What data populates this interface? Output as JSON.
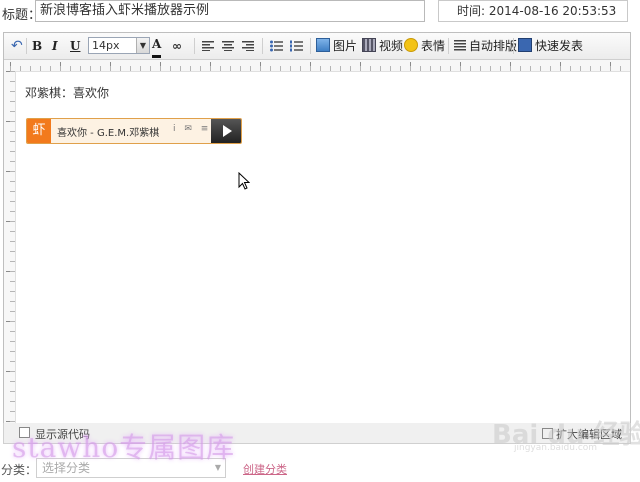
{
  "title_row": {
    "label": "标题：",
    "value": "新浪博客插入虾米播放器示例",
    "time_text": "时间: 2014-08-16 20:53:53"
  },
  "toolbar": {
    "undo": "↶",
    "bold": "B",
    "italic": "I",
    "underline": "U",
    "font_size": "14px",
    "font_color": "A",
    "link": "∞",
    "image": "图片",
    "video": "视频",
    "emoticon": "表情",
    "auto_layout": "自动排版",
    "quick_publish": "快速发表"
  },
  "content": {
    "text": "邓紫棋：喜欢你",
    "player": {
      "logo": "虾",
      "song": "喜欢你 - G.E.M.邓紫棋",
      "mini_icons": "i ✉ ≡"
    }
  },
  "footer": {
    "show_source": "显示源代码",
    "expand_area": "扩大编辑区域"
  },
  "category": {
    "label": "分类：",
    "placeholder": "选择分类",
    "create": "创建分类"
  },
  "watermarks": {
    "stawho": "stawho专属图库",
    "baidu": "Bai du 经验",
    "baidu_sub": "jingyan.baidu.com"
  }
}
